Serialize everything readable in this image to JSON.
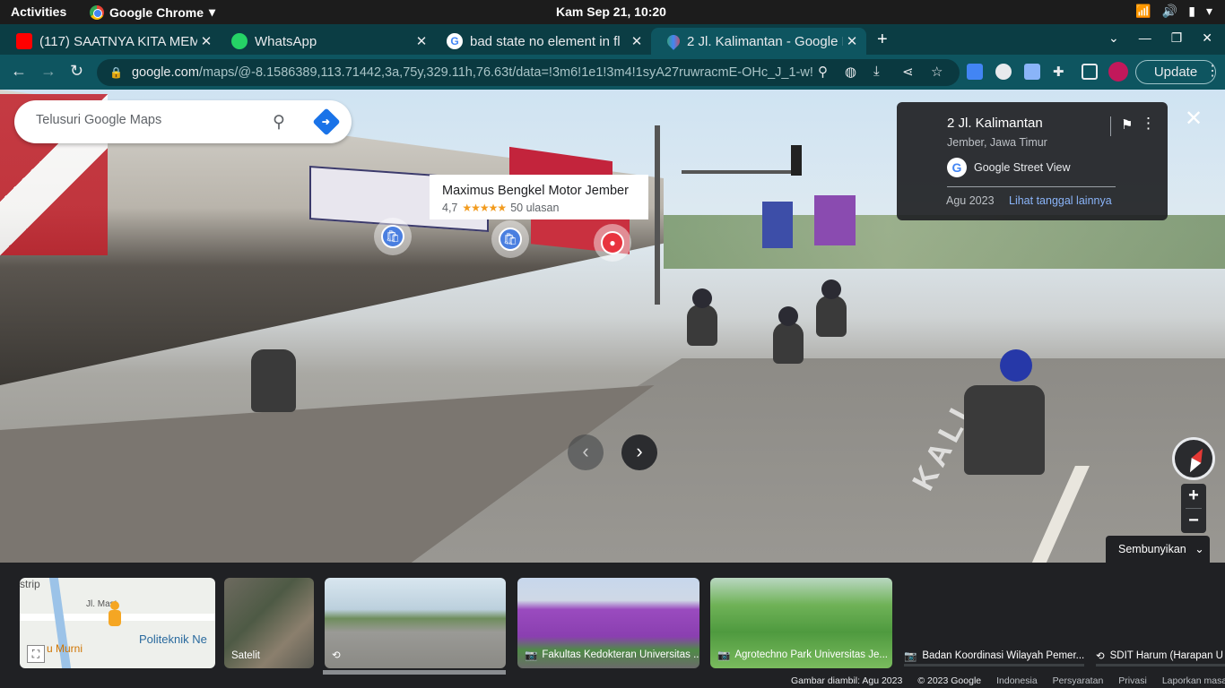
{
  "topbar": {
    "activities": "Activities",
    "app_name": "Google Chrome",
    "app_menu_icon": "chevron-down-icon",
    "clock": "Kam Sep 21, 10:20",
    "tray_icons": [
      "wifi-icon",
      "volume-icon",
      "battery-icon",
      "chevron-down-icon"
    ]
  },
  "tabs": [
    {
      "title": "(117) SAATNYA KITA MEM",
      "favicon": "youtube-icon",
      "favicon_color": "#ff0000",
      "active": false
    },
    {
      "title": "WhatsApp",
      "favicon": "whatsapp-icon",
      "favicon_color": "#25d366",
      "active": false
    },
    {
      "title": "bad state no element in fl",
      "favicon": "google-icon",
      "favicon_color": "#4285f4",
      "active": false
    },
    {
      "title": "2 Jl. Kalimantan - Google M",
      "favicon": "google-maps-icon",
      "favicon_color": "#34a853",
      "active": true
    }
  ],
  "toolbar": {
    "url_host": "google.com",
    "url_path": "/maps/@-8.1586389,113.71442,3a,75y,329.11h,76.63t/data=!3m6!1e1!3m4!1syA27ruwracmE-OHc_J_1-w!...",
    "update_label": "Update"
  },
  "search": {
    "placeholder": "Telusuri Google Maps"
  },
  "place": {
    "name": "Maximus Bengkel Motor Jember",
    "rating": "4,7",
    "stars": "★★★★★",
    "rating_value": 4.7,
    "reviews": "50 ulasan"
  },
  "info_panel": {
    "address": "2 Jl. Kalimantan",
    "city": "Jember, Jawa Timur",
    "source": "Google Street View",
    "date": "Agu 2023",
    "more_dates": "Lihat tanggal lainnya"
  },
  "controls": {
    "hide_label": "Sembunyikan",
    "zoom_in": "+",
    "zoom_out": "−"
  },
  "minimap": {
    "label_strip": "strip",
    "label_street": "Jl. Mast",
    "label_poltek": "Politeknik Ne",
    "label_murni": "u Murni"
  },
  "thumbs": {
    "satellite": "Satelit",
    "fakultas": "Fakultas Kedokteran Universitas ...",
    "agro": "Agrotechno Park Universitas Je...",
    "badan": "Badan Koordinasi Wilayah Pemer...",
    "sdit": "SDIT Harum (Harapan U"
  },
  "footer": {
    "captured": "Gambar diambil: Agu 2023",
    "copyright": "© 2023 Google",
    "country": "Indonesia",
    "terms": "Persyaratan",
    "privacy": "Privasi",
    "report": "Laporkan masalah"
  }
}
